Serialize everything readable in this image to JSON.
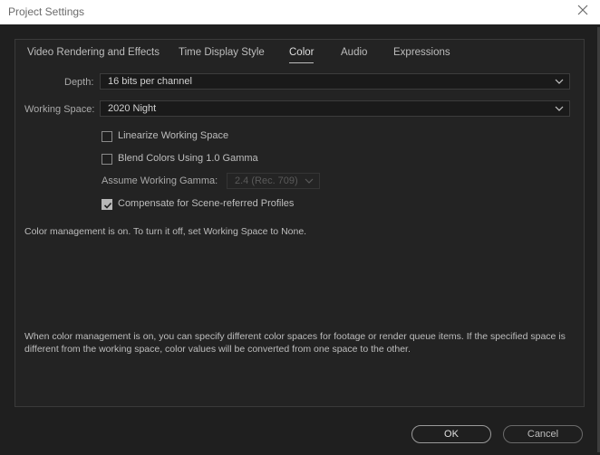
{
  "window": {
    "title": "Project Settings"
  },
  "tabs": [
    {
      "label": "Video Rendering and Effects",
      "active": false
    },
    {
      "label": "Time Display Style",
      "active": false
    },
    {
      "label": "Color",
      "active": true
    },
    {
      "label": "Audio",
      "active": false
    },
    {
      "label": "Expressions",
      "active": false
    }
  ],
  "color": {
    "depth": {
      "label": "Depth:",
      "value": "16 bits per channel"
    },
    "working_space": {
      "label": "Working Space:",
      "value": "2020 Night"
    },
    "linearize": {
      "label": "Linearize Working Space",
      "checked": false
    },
    "blend": {
      "label": "Blend Colors Using 1.0 Gamma",
      "checked": false
    },
    "gamma": {
      "label": "Assume Working Gamma:",
      "value": "2.4 (Rec. 709)",
      "disabled": true
    },
    "compensate": {
      "label": "Compensate for Scene-referred Profiles",
      "checked": true
    },
    "status_text": "Color management is on. To turn it off, set Working Space to None.",
    "help_text_line1": "When color management is on, you can specify different color spaces for footage or render queue items. If the specified space is",
    "help_text_line2": "different from the working space, color values will be converted from one space to the other."
  },
  "buttons": {
    "ok": "OK",
    "cancel": "Cancel"
  }
}
